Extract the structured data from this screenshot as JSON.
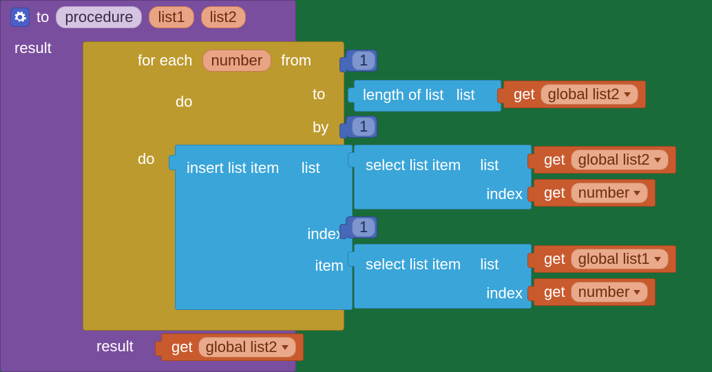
{
  "procedure": {
    "to_label": "to",
    "name": "procedure",
    "params": [
      "list1",
      "list2"
    ],
    "result_label": "result"
  },
  "foreach": {
    "do_label": "do",
    "prefix": "for each",
    "varname": "number",
    "from_label": "from",
    "from_value": "1",
    "to_label": "to",
    "by_label": "by",
    "by_value": "1",
    "inner_do_label": "do",
    "result_label": "result"
  },
  "length_of_list": {
    "label": "length of list",
    "socket": "list"
  },
  "insert": {
    "label": "insert list item",
    "list_socket": "list",
    "index_label": "index",
    "index_value": "1",
    "item_label": "item"
  },
  "select1": {
    "label": "select list item",
    "list_socket": "list",
    "index_label": "index"
  },
  "select2": {
    "label": "select list item",
    "list_socket": "list",
    "index_label": "index"
  },
  "get_label": "get",
  "vars": {
    "global_list2": "global list2",
    "global_list1": "global list1",
    "number": "number"
  }
}
